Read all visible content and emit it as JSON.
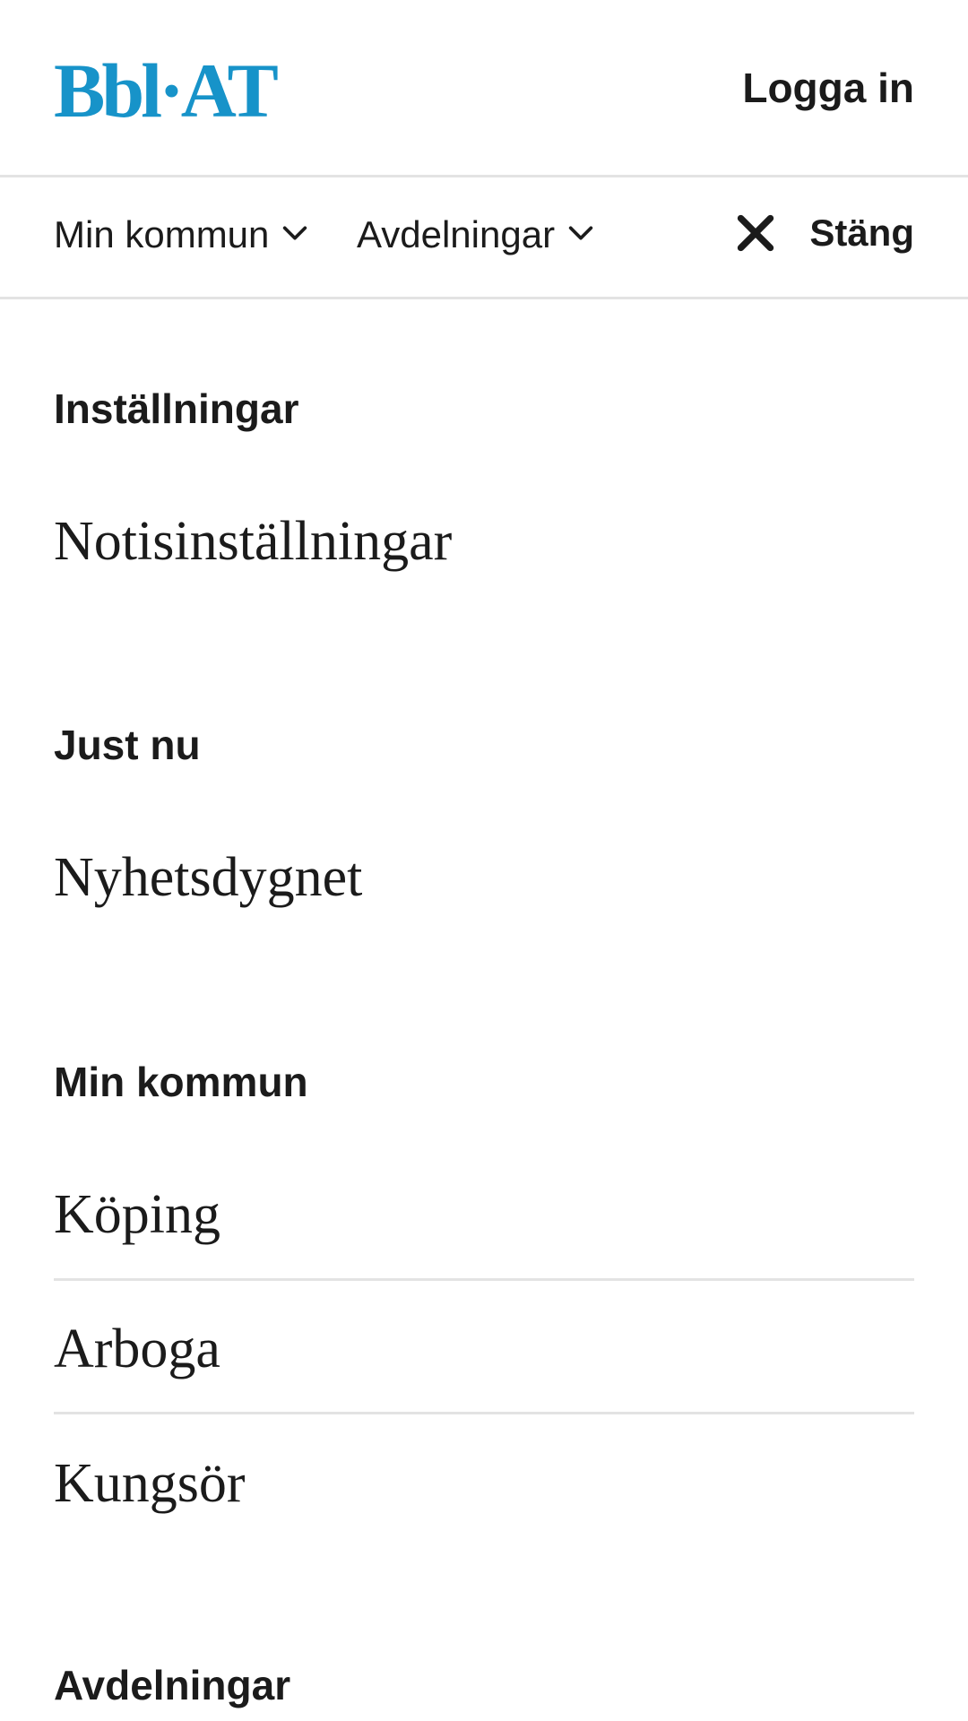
{
  "header": {
    "logo_text": "Bbl·AT",
    "login_label": "Logga in",
    "brand_color": "#1793c9"
  },
  "nav": {
    "items": [
      {
        "label": "Min kommun",
        "icon": "chevron-down-icon"
      },
      {
        "label": "Avdelningar",
        "icon": "chevron-down-icon"
      }
    ],
    "close_label": "Stäng",
    "close_icon": "close-icon"
  },
  "menu": {
    "sections": [
      {
        "heading": "Inställningar",
        "links": [
          "Notisinställningar"
        ]
      },
      {
        "heading": "Just nu",
        "links": [
          "Nyhetsdygnet"
        ]
      },
      {
        "heading": "Min kommun",
        "links": [
          "Köping",
          "Arboga",
          "Kungsör"
        ]
      },
      {
        "heading": "Avdelningar",
        "links": []
      }
    ]
  }
}
